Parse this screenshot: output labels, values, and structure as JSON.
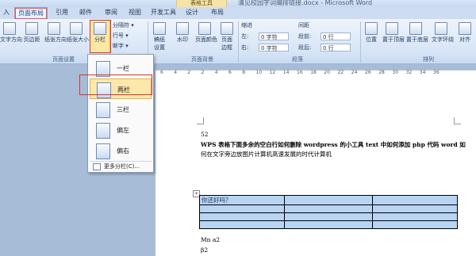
{
  "title_bar": {
    "title": "清见校园字词编排链接.docx - Microsoft Word",
    "context_tab": "表格工具"
  },
  "tabs": [
    {
      "label": "入"
    },
    {
      "label": "页面布局",
      "active": true
    },
    {
      "label": "引用"
    },
    {
      "label": "邮件"
    },
    {
      "label": "审阅"
    },
    {
      "label": "视图"
    },
    {
      "label": "开发工具"
    },
    {
      "label": "设计"
    },
    {
      "label": "布局"
    }
  ],
  "ribbon": {
    "page_setup": {
      "label": "页面设置",
      "buttons": [
        "文字方向",
        "页边距",
        "纸张方向",
        "纸张大小",
        "分栏"
      ],
      "small": [
        "分隔符 ▾",
        "行号 ▾",
        "断字 ▾"
      ]
    },
    "page_bg": {
      "label": "页面背景",
      "buttons": [
        "稿纸设置",
        "水印",
        "页面颜色",
        "页面边框"
      ]
    },
    "paragraph": {
      "label": "段落",
      "indent_title": "缩进",
      "spacing_title": "间距",
      "left_label": "左:",
      "left_value": "0 字符",
      "right_label": "右:",
      "right_value": "0 字符",
      "before_label": "段前:",
      "before_value": "0 行",
      "after_label": "段后:",
      "after_value": "0 行"
    },
    "arrange": {
      "label": "排列",
      "buttons": [
        "位置",
        "置于顶层",
        "置于底层",
        "文字环绕",
        "对齐"
      ]
    }
  },
  "dropdown": {
    "items": [
      {
        "label": "一栏"
      },
      {
        "label": "两栏",
        "highlighted": true
      },
      {
        "label": "三栏"
      },
      {
        "label": "偏左"
      },
      {
        "label": "偏右"
      }
    ],
    "more": "更多分栏(C)..."
  },
  "ruler_numbers": [
    "6",
    "4",
    "2",
    "2",
    "4",
    "6",
    "8",
    "10",
    "12",
    "14",
    "16",
    "18",
    "20",
    "22",
    "24",
    "26",
    "28",
    "30",
    "32",
    "34",
    "36"
  ],
  "document": {
    "line1": "52",
    "line2": "WPS 表格下面多余的空白行如何删除 wordpress 的小工具 text 中如何添加 php 代码 word 如",
    "line3": "何在文字旁边放图片计算机高速发展的时代计算机",
    "table_first_cell": "你还好吗？",
    "line4": "Mn      a2",
    "line5": "β2"
  },
  "colors": {
    "accent": "#e03131",
    "ribbon": "#d6e4f5",
    "highlight": "#fde8ac"
  }
}
